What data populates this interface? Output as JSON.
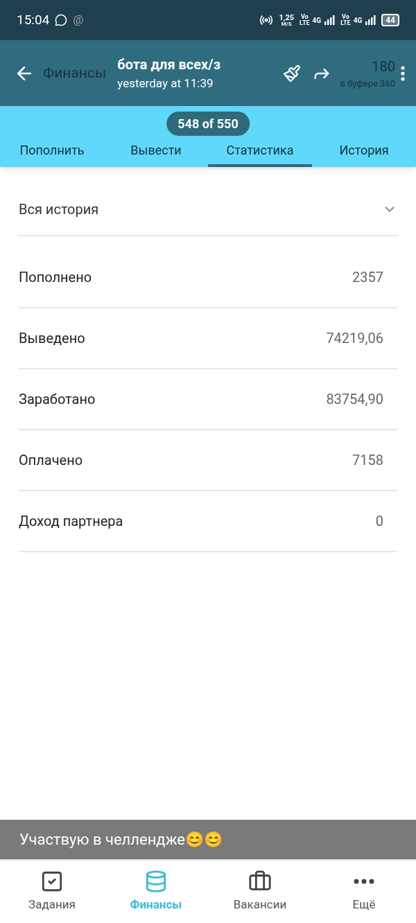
{
  "status_bar": {
    "time": "15:04",
    "at_sign": "@",
    "speed": [
      "1,25",
      "M/S"
    ],
    "sims": [
      {
        "volte": [
          "Vo",
          "LTE"
        ],
        "network": "4G"
      },
      {
        "volte": [
          "Vo",
          "LTE"
        ],
        "network": "4G"
      }
    ],
    "battery": "44"
  },
  "viewer": {
    "title": "бота для всех/з",
    "subtitle": "yesterday at 11:39",
    "counter": "548 of 550",
    "caption": "Участвую в челлендже😊😊"
  },
  "header": {
    "title": "Финансы",
    "balance": "180",
    "buffer": "в буфере 360"
  },
  "tabs": [
    {
      "label": "Пополнить",
      "selected": false
    },
    {
      "label": "Вывести",
      "selected": false
    },
    {
      "label": "Статистика",
      "selected": true
    },
    {
      "label": "История",
      "selected": false
    }
  ],
  "filter": {
    "value": "Вся история"
  },
  "rows": [
    {
      "label": "Пополнено",
      "value": "2357"
    },
    {
      "label": "Выведено",
      "value": "74219,06"
    },
    {
      "label": "Заработано",
      "value": "83754,90"
    },
    {
      "label": "Оплачено",
      "value": "7158"
    },
    {
      "label": "Доход партнера",
      "value": "0"
    }
  ],
  "nav": [
    {
      "kind": "tasks",
      "label": "Задания",
      "selected": false
    },
    {
      "kind": "finance",
      "label": "Финансы",
      "selected": true
    },
    {
      "kind": "jobs",
      "label": "Вакансии",
      "selected": false
    },
    {
      "kind": "more",
      "label": "Ещё",
      "selected": false
    }
  ]
}
